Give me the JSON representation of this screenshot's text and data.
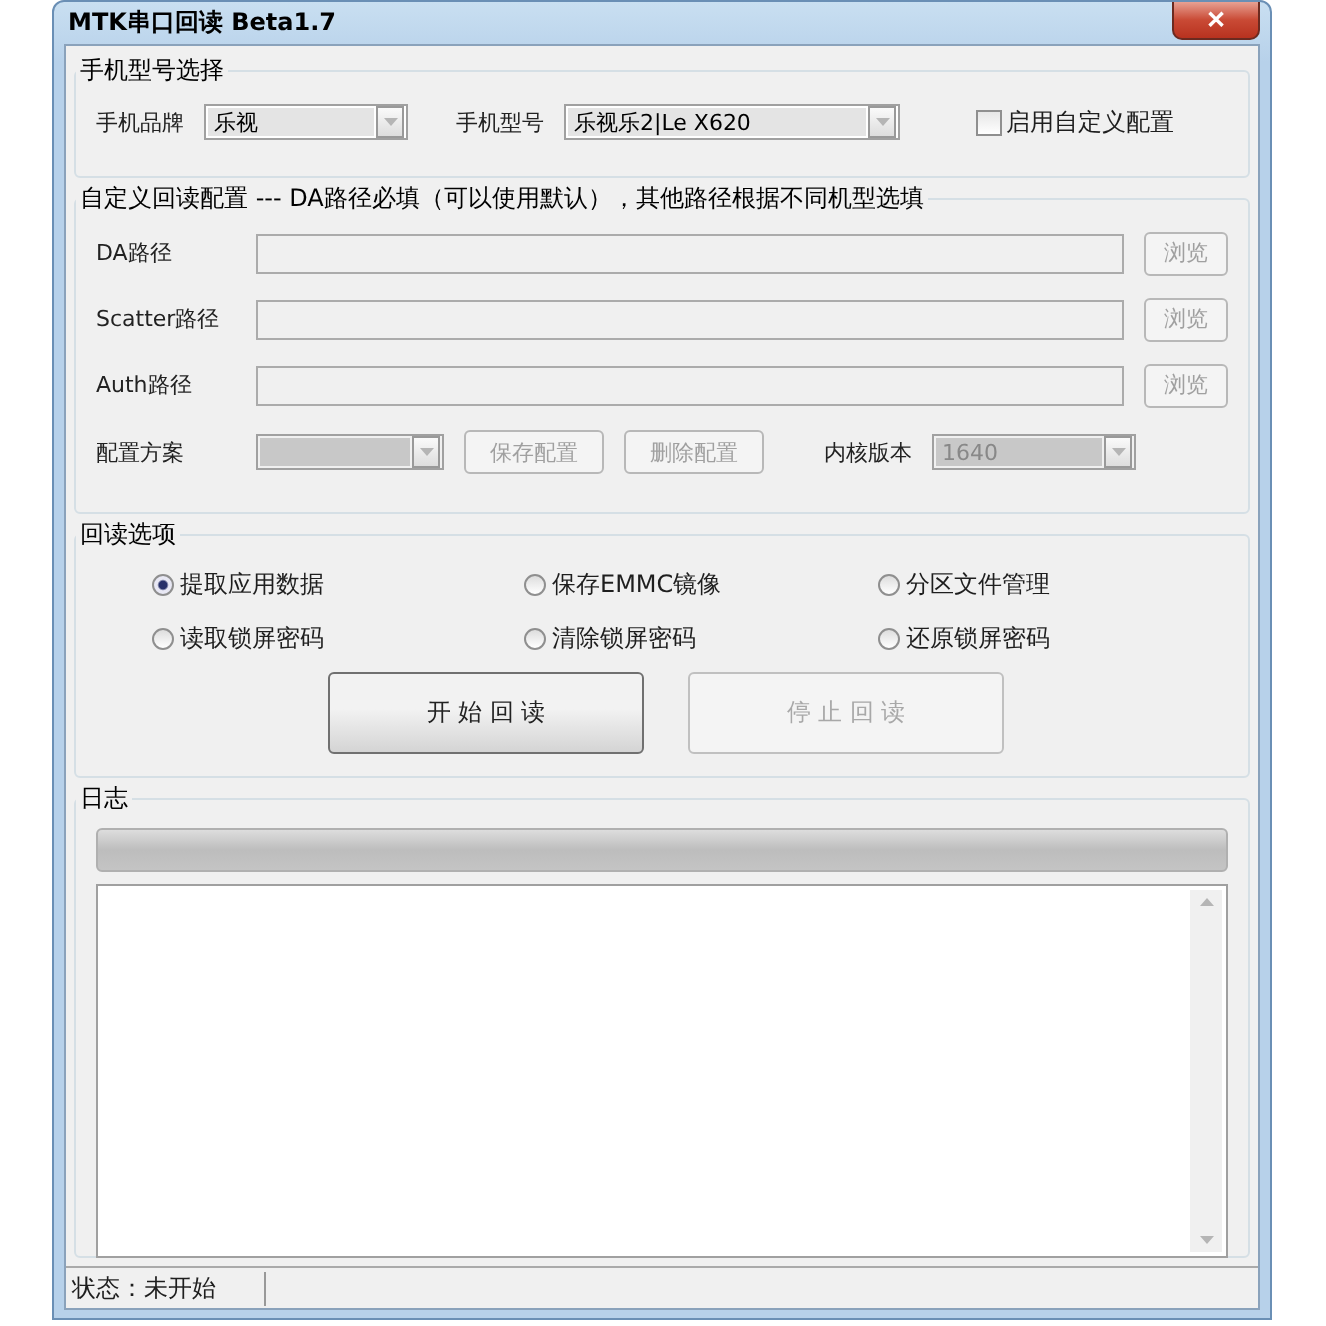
{
  "window": {
    "title": "MTK串口回读 Beta1.7",
    "close": "✕"
  },
  "model_select": {
    "legend": "手机型号选择",
    "brand_label": "手机品牌",
    "brand_value": "乐视",
    "model_label": "手机型号",
    "model_value": "乐视乐2|Le X620",
    "custom_config": {
      "label": "启用自定义配置",
      "checked": false
    }
  },
  "custom": {
    "legend": "自定义回读配置  ---  DA路径必填（可以使用默认），其他路径根据不同机型选填",
    "paths": [
      {
        "label": "DA路径",
        "button": "浏览",
        "disabled": true
      },
      {
        "label": "Scatter路径",
        "button": "浏览",
        "disabled": true
      },
      {
        "label": "Auth路径",
        "button": "浏览",
        "disabled": true
      }
    ],
    "scheme_label": "配置方案",
    "scheme_disabled": true,
    "save": {
      "label": "保存配置",
      "disabled": true
    },
    "delete": {
      "label": "删除配置",
      "disabled": true
    },
    "kernel_label": "内核版本",
    "kernel_value": "1640",
    "kernel_disabled": true
  },
  "options": {
    "legend": "回读选项",
    "radios": [
      {
        "label": "提取应用数据",
        "selected": true
      },
      {
        "label": "保存EMMC镜像",
        "selected": false
      },
      {
        "label": "分区文件管理",
        "selected": false
      },
      {
        "label": "读取锁屏密码",
        "selected": false
      },
      {
        "label": "清除锁屏密码",
        "selected": false
      },
      {
        "label": "还原锁屏密码",
        "selected": false
      }
    ],
    "start": {
      "label": "开 始 回 读",
      "disabled": false
    },
    "stop": {
      "label": "停 止 回 读",
      "disabled": true
    }
  },
  "log": {
    "legend": "日志",
    "progress": {
      "level": 0
    }
  },
  "status_bar": {
    "text": "状态：未开始"
  }
}
